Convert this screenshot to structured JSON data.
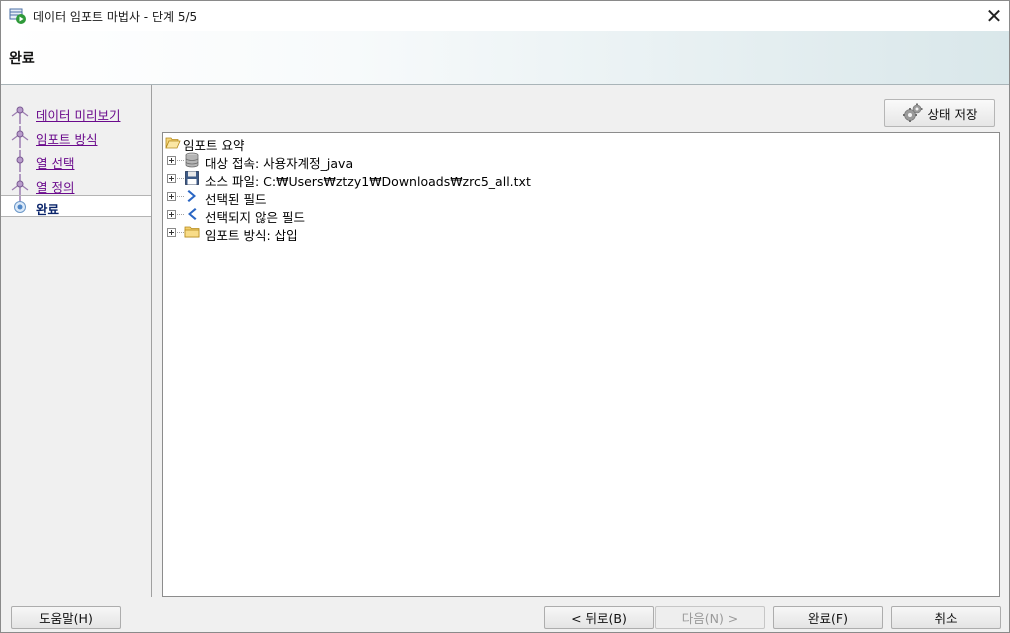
{
  "window": {
    "title": "데이터 임포트 마법사 - 단계 5/5",
    "close_glyph": "✕"
  },
  "header": {
    "heading": "완료"
  },
  "steps": [
    {
      "label": "데이터 미리보기",
      "state": "visited"
    },
    {
      "label": "임포트 방식",
      "state": "visited"
    },
    {
      "label": "열 선택",
      "state": "visited"
    },
    {
      "label": "열 정의",
      "state": "visited"
    },
    {
      "label": "완료",
      "state": "current"
    }
  ],
  "toolbar": {
    "save_state_label": "상태 저장",
    "save_state_icon": "gears-icon"
  },
  "tree": {
    "root": {
      "label": "임포트 요약",
      "icon": "open-folder-icon"
    },
    "children": [
      {
        "label": "대상 접속: 사용자계정_java",
        "icon": "database-icon"
      },
      {
        "label": "소스 파일: C:₩Users₩ztzy1₩Downloads₩zrc5_all.txt",
        "icon": "floppy-disk-icon"
      },
      {
        "label": "선택된 필드",
        "icon": "chevron-right-icon"
      },
      {
        "label": "선택되지 않은 필드",
        "icon": "chevron-left-icon"
      },
      {
        "label": "임포트 방식: 삽입",
        "icon": "folder-icon"
      }
    ]
  },
  "buttons": {
    "help": "도움말(H)",
    "back": "< 뒤로(B)",
    "next": "다음(N) >",
    "finish": "완료(F)",
    "cancel": "취소"
  },
  "colors": {
    "visited_link": "#6a0a8c",
    "current_step": "#0a246a",
    "header_gradient_end": "#d9e7ea"
  }
}
